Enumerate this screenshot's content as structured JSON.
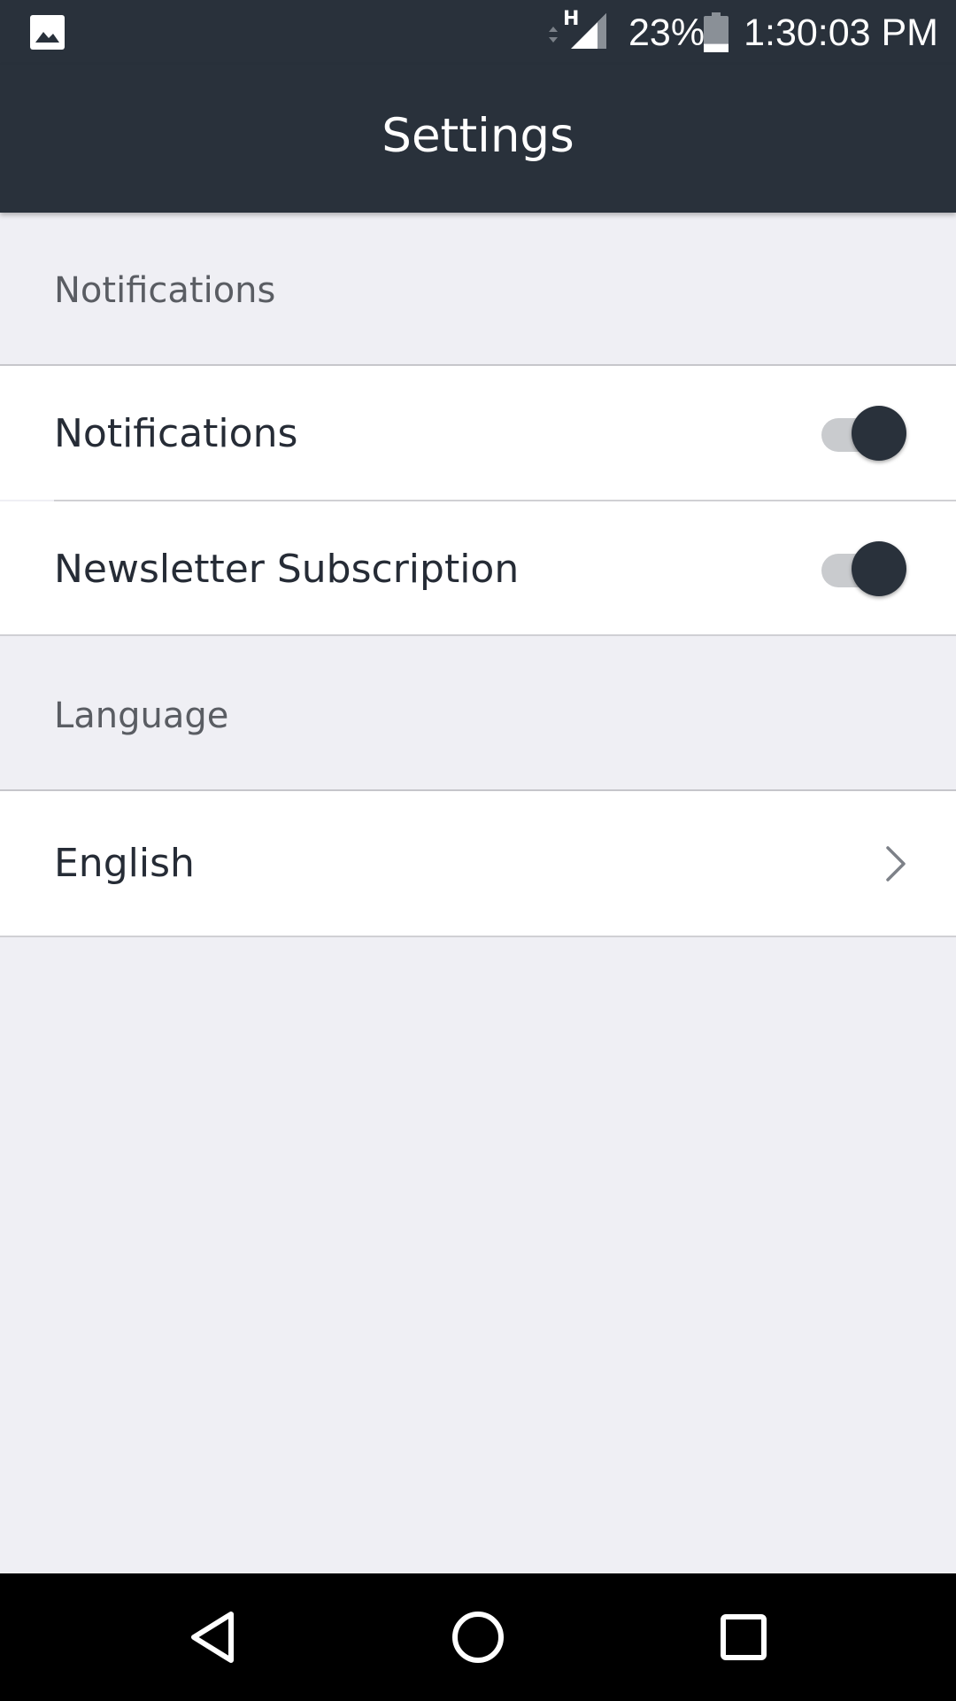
{
  "status_bar": {
    "network_type": "H",
    "battery_percent": "23%",
    "battery_level": 0.23,
    "time": "1:30:03 PM",
    "icons": [
      "gallery-icon",
      "data-arrows-icon",
      "signal-icon",
      "battery-icon"
    ]
  },
  "app_bar": {
    "title": "Settings"
  },
  "sections": {
    "notifications": {
      "header": "Notifications",
      "rows": [
        {
          "label": "Notifications",
          "toggle_on": true
        },
        {
          "label": "Newsletter Subscription",
          "toggle_on": true
        }
      ]
    },
    "language": {
      "header": "Language",
      "current": "English",
      "chevron_icon": "chevron-right-icon"
    }
  },
  "nav_bar": {
    "icons": [
      "back-icon",
      "home-icon",
      "recents-icon"
    ]
  },
  "colors": {
    "app_bar": "#29313b",
    "background": "#efeff4",
    "toggle_thumb": "#29313b",
    "toggle_track": "#c9cbce",
    "text_primary": "#262c36",
    "text_secondary": "#5a5d63"
  }
}
